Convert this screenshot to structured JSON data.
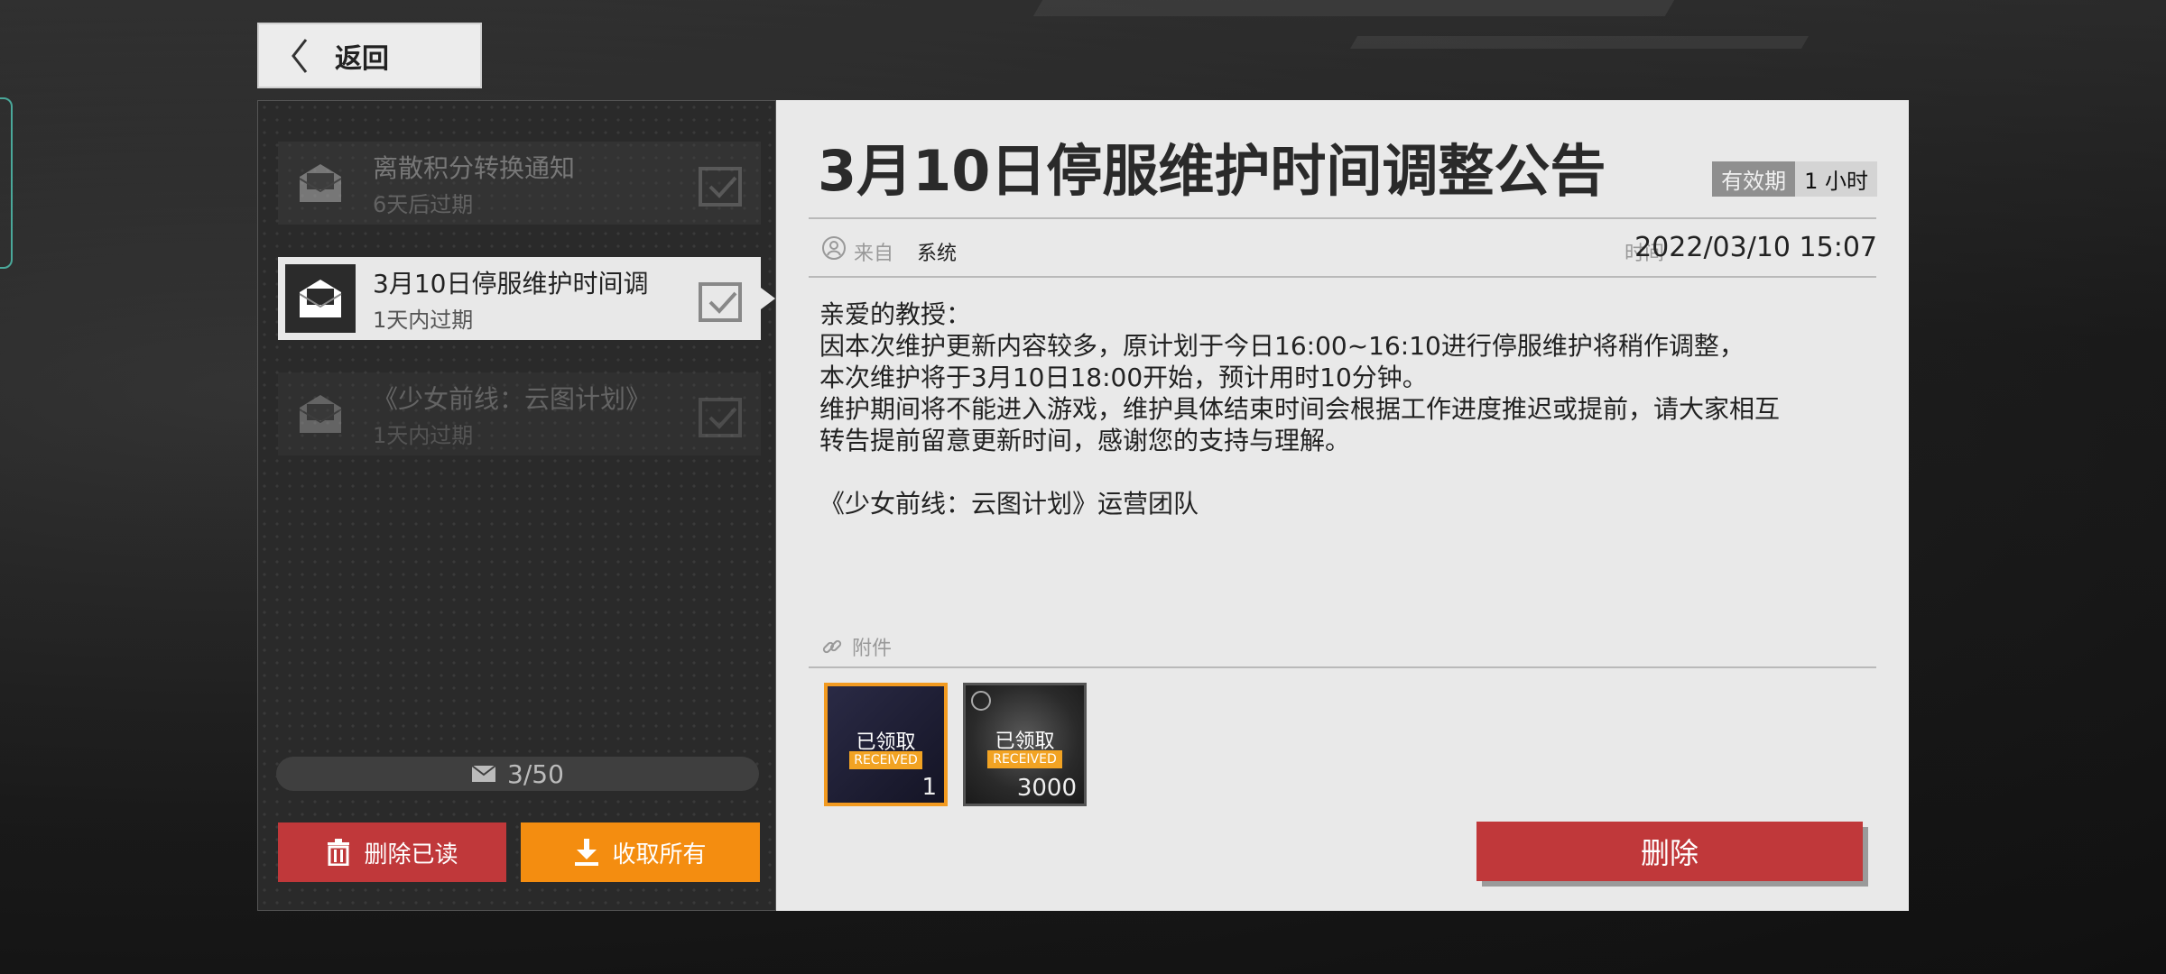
{
  "header": {
    "back_label": "返回"
  },
  "mail_list": {
    "items": [
      {
        "title": "离散积分转换通知",
        "subtitle": "6天后过期",
        "state": "read"
      },
      {
        "title": "3月10日停服维护时间调",
        "subtitle": "1天内过期",
        "state": "selected"
      },
      {
        "title": "《少女前线：云图计划》",
        "subtitle": "1天内过期",
        "state": "read"
      }
    ],
    "count": "3/50",
    "delete_read_label": "删除已读",
    "collect_all_label": "收取所有"
  },
  "mail_detail": {
    "title": "3月10日停服维护时间调整公告",
    "validity_label": "有效期",
    "validity_value": "1 小时",
    "from_label": "来自",
    "from_value": "系统",
    "time_label": "时间",
    "time_value": "2022/03/10 15:07",
    "body": {
      "line1": "亲爱的教授：",
      "line2": "因本次维护更新内容较多，原计划于今日16:00~16:10进行停服维护将稍作调整，",
      "line3": "本次维护将于3月10日18:00开始，预计用时10分钟。",
      "line4": "维护期间将不能进入游戏，维护具体结束时间会根据工作进度推迟或提前，请大家相互",
      "line5": "转告提前留意更新时间，感谢您的支持与理解。",
      "signature": "《少女前线：云图计划》运营团队"
    },
    "attachments_label": "附件",
    "attachments": [
      {
        "status": "已领取",
        "status_en": "RECEIVED",
        "count": "1"
      },
      {
        "status": "已领取",
        "status_en": "RECEIVED",
        "count": "3000"
      }
    ],
    "delete_label": "删除"
  },
  "colors": {
    "accent_red": "#c0383a",
    "accent_orange": "#f48d10",
    "panel_light": "#e9e9e9",
    "panel_dark": "#2a2a2a"
  }
}
